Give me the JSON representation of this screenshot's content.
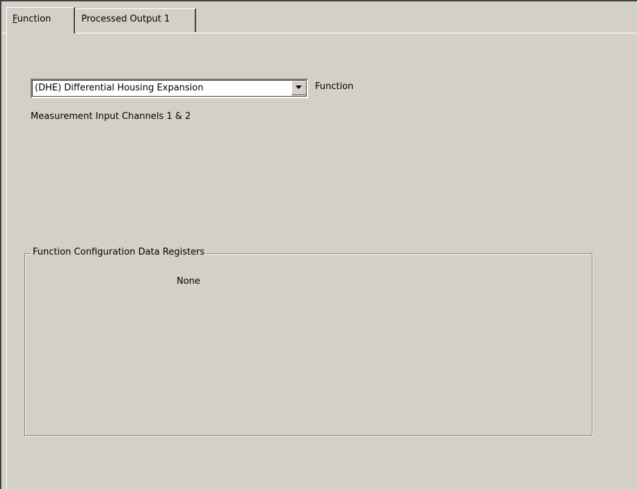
{
  "tabs": [
    {
      "label_accel": "F",
      "label_rest": "unction",
      "active": true
    },
    {
      "label": "Processed Output 1",
      "active": false
    }
  ],
  "function_select": {
    "value": "(DHE) Differential Housing Expansion",
    "label": "Function"
  },
  "channels_text": "Measurement Input Channels 1 & 2",
  "config_group": {
    "title": "Function Configuration Data Registers",
    "content": "None"
  }
}
